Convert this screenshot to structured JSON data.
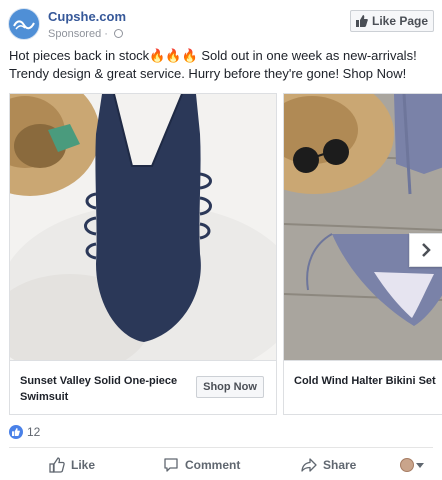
{
  "header": {
    "page_name": "Cupshe.com",
    "sponsored": "Sponsored · ",
    "like_page_label": "Like Page"
  },
  "post": {
    "text": "Hot pieces back in stock🔥🔥🔥 Sold out in one week as new-arrivals! Trendy design & great service. Hurry before they're gone! Shop Now!"
  },
  "carousel": {
    "cards": [
      {
        "title": "Sunset Valley Solid One-piece Swimsuit",
        "cta": "Shop Now",
        "image": "navy one-piece swimsuit on white fur with straw hat"
      },
      {
        "title": "Cold Wind Halter Bikini Set",
        "image": "blue-gray halter bikini on wood with straw hat and sunglasses"
      }
    ],
    "next_icon": "chevron-right-icon"
  },
  "reactions": {
    "count": "12"
  },
  "actions": {
    "like": "Like",
    "comment": "Comment",
    "share": "Share"
  },
  "colors": {
    "brand_blue": "#365899",
    "like_blue": "#4a81e8",
    "text": "#1d2129",
    "muted": "#90949c"
  }
}
